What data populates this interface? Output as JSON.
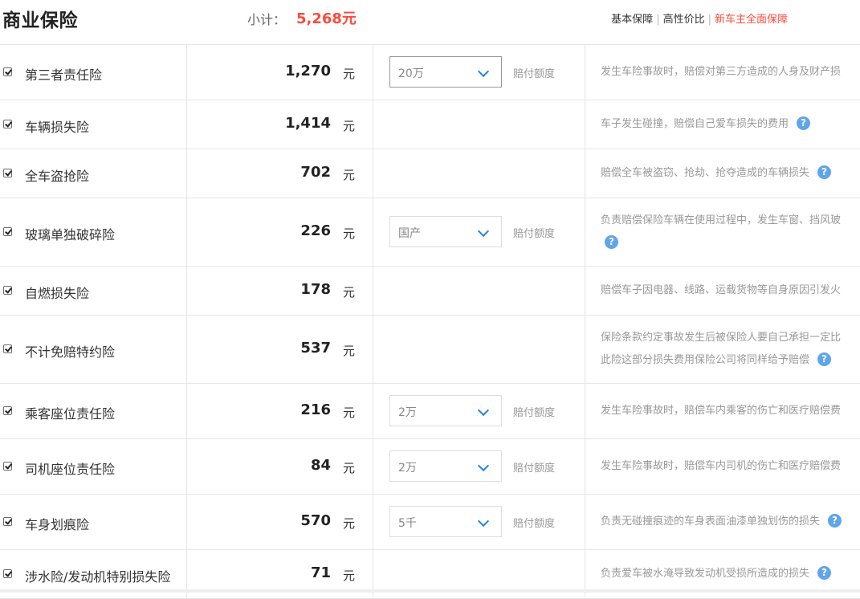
{
  "header": {
    "title": "商业保险",
    "subtotal_label": "小计：",
    "subtotal_value": "5,268元",
    "plans": [
      "基本保障",
      "高性价比",
      "新车主全面保障"
    ],
    "separator": "|"
  },
  "unit": "元",
  "select_suffix": "赔付额度",
  "help_glyph": "?",
  "rows": [
    {
      "name": "第三者责任险",
      "price": "1,270",
      "checked": true,
      "select": "20万",
      "desc_lines": [
        "发生车险事故时，赔偿对第三方造成的人身及财产损"
      ],
      "help": false
    },
    {
      "name": "车辆损失险",
      "price": "1,414",
      "checked": true,
      "select": null,
      "desc_lines": [
        "车子发生碰撞，赔偿自己爱车损失的费用"
      ],
      "help": true
    },
    {
      "name": "全车盗抢险",
      "price": "702",
      "checked": true,
      "select": null,
      "desc_lines": [
        "赔偿全车被盗窃、抢劫、抢夺造成的车辆损失"
      ],
      "help": true
    },
    {
      "name": "玻璃单独破碎险",
      "price": "226",
      "checked": true,
      "select": "国产",
      "desc_lines": [
        "负责赔偿保险车辆在使用过程中，发生车窗、挡风玻",
        ""
      ],
      "help": true
    },
    {
      "name": "自燃损失险",
      "price": "178",
      "checked": true,
      "select": null,
      "desc_lines": [
        "赔偿车子因电器、线路、运载货物等自身原因引发火"
      ],
      "help": false
    },
    {
      "name": "不计免赔特约险",
      "price": "537",
      "checked": true,
      "select": null,
      "desc_lines": [
        "保险条款约定事故发生后被保险人要自己承担一定比",
        "此险这部分损失费用保险公司将同样给予赔偿"
      ],
      "help": true
    },
    {
      "name": "乘客座位责任险",
      "price": "216",
      "checked": true,
      "select": "2万",
      "desc_lines": [
        "发生车险事故时，赔偿车内乘客的伤亡和医疗赔偿费"
      ],
      "help": false
    },
    {
      "name": "司机座位责任险",
      "price": "84",
      "checked": true,
      "select": "2万",
      "desc_lines": [
        "发生车险事故时，赔偿车内司机的伤亡和医疗赔偿费"
      ],
      "help": false
    },
    {
      "name": "车身划痕险",
      "price": "570",
      "checked": true,
      "select": "5千",
      "desc_lines": [
        "负责无碰撞痕迹的车身表面油漆单独划伤的损失"
      ],
      "help": true
    },
    {
      "name": "涉水险/发动机特别损失险",
      "price": "71",
      "checked": true,
      "select": null,
      "desc_lines": [
        "负责爱车被水淹导致发动机受损所造成的损失"
      ],
      "help": true
    }
  ]
}
